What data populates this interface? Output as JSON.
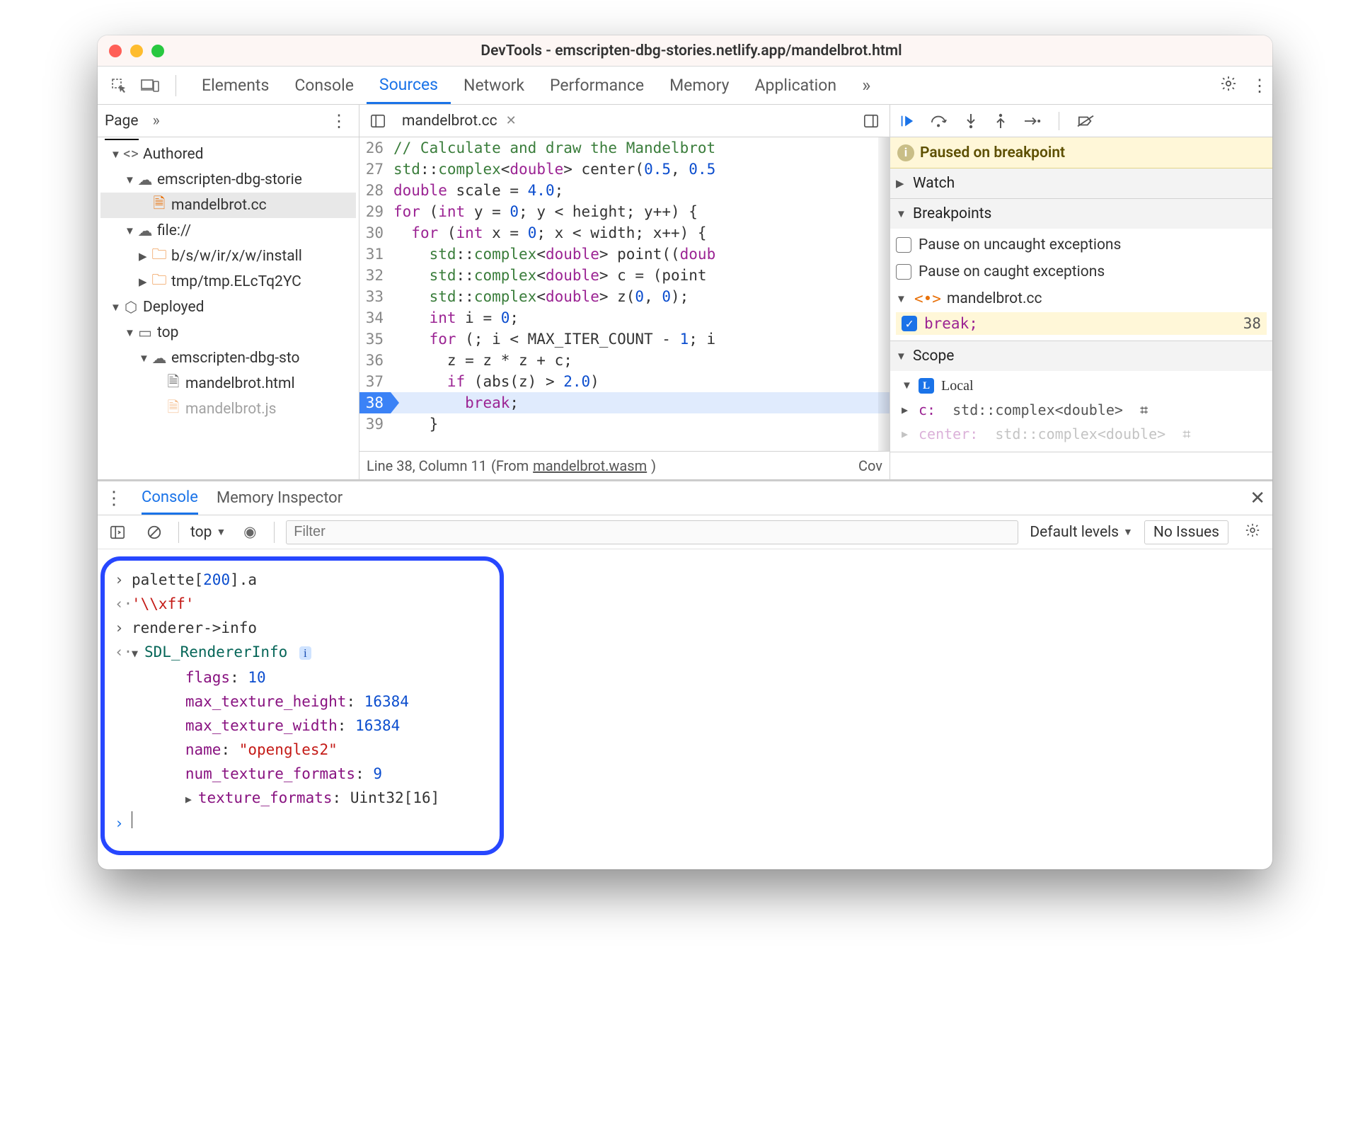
{
  "window": {
    "title": "DevTools - emscripten-dbg-stories.netlify.app/mandelbrot.html"
  },
  "toptabs": [
    "Elements",
    "Console",
    "Sources",
    "Network",
    "Performance",
    "Memory",
    "Application"
  ],
  "toptabs_active": "Sources",
  "left": {
    "page_label": "Page",
    "tree": {
      "authored": "Authored",
      "origin1": "emscripten-dbg-storie",
      "file1": "mandelbrot.cc",
      "fileorigin": "file://",
      "filesub1": "b/s/w/ir/x/w/install",
      "filesub2": "tmp/tmp.ELcTq2YC",
      "deployed": "Deployed",
      "top": "top",
      "origin2": "emscripten-dbg-sto",
      "html": "mandelbrot.html",
      "js": "mandelbrot.js"
    }
  },
  "editor": {
    "filename": "mandelbrot.cc",
    "status_line": "Line 38, Column 11",
    "status_from": "(From ",
    "status_wasm": "mandelbrot.wasm",
    "status_cov": "Cov",
    "lines": [
      {
        "n": 26,
        "html": "<span class='k-cm'>// Calculate and draw the Mandelbrot</span>"
      },
      {
        "n": 27,
        "html": "<span class='k-ns'>std</span>::<span class='k-ns'>complex</span>&lt;<span class='k-kw'>double</span>&gt; center(<span class='k-num'>0.5</span>, <span class='k-num'>0.5</span>"
      },
      {
        "n": 28,
        "html": "<span class='k-kw'>double</span> scale = <span class='k-num'>4.0</span>;"
      },
      {
        "n": 29,
        "html": "<span class='k-kw'>for</span> (<span class='k-kw'>int</span> y = <span class='k-num'>0</span>; y &lt; height; y++) {"
      },
      {
        "n": 30,
        "html": "  <span class='k-kw'>for</span> (<span class='k-kw'>int</span> x = <span class='k-num'>0</span>; x &lt; width; x++) {"
      },
      {
        "n": 31,
        "html": "    <span class='k-ns'>std</span>::<span class='k-ns'>complex</span>&lt;<span class='k-kw'>double</span>&gt; point((<span class='k-kw'>doub</span>"
      },
      {
        "n": 32,
        "html": "    <span class='k-ns'>std</span>::<span class='k-ns'>complex</span>&lt;<span class='k-kw'>double</span>&gt; c = (point "
      },
      {
        "n": 33,
        "html": "    <span class='k-ns'>std</span>::<span class='k-ns'>complex</span>&lt;<span class='k-kw'>double</span>&gt; z(<span class='k-num'>0</span>, <span class='k-num'>0</span>);"
      },
      {
        "n": 34,
        "html": "    <span class='k-kw'>int</span> i = <span class='k-num'>0</span>;"
      },
      {
        "n": 35,
        "html": "    <span class='k-kw'>for</span> (; i &lt; MAX_ITER_COUNT - <span class='k-num'>1</span>; i"
      },
      {
        "n": 36,
        "html": "      z = z * z + c;"
      },
      {
        "n": 37,
        "html": "      <span class='k-kw'>if</span> (abs(z) &gt; <span class='k-num'>2.0</span>)"
      },
      {
        "n": 38,
        "html": "        <span class='k-kw'>break</span>;",
        "exec": true
      },
      {
        "n": 39,
        "html": "    }"
      }
    ]
  },
  "debugger": {
    "paused": "Paused on breakpoint",
    "watch": "Watch",
    "breakpoints": "Breakpoints",
    "pause_uncaught": "Pause on uncaught exceptions",
    "pause_caught": "Pause on caught exceptions",
    "bp_file": "mandelbrot.cc",
    "bp_code": "break;",
    "bp_line": "38",
    "scope": "Scope",
    "local": "Local",
    "var1_name": "c:",
    "var1_type": "std::complex<double>",
    "var2_name": "center:",
    "var2_type": "std::complex<double>"
  },
  "drawer": {
    "tabs": [
      "Console",
      "Memory Inspector"
    ],
    "active": "Console",
    "ctx": "top",
    "filter_placeholder": "Filter",
    "levels": "Default levels",
    "issues": "No Issues"
  },
  "console": {
    "in1": "palette[200].a",
    "out1": "'\\\\xff'",
    "in2": "renderer->info",
    "struct": "SDL_RendererInfo",
    "fields": [
      {
        "k": "flags",
        "v": "10",
        "t": "num"
      },
      {
        "k": "max_texture_height",
        "v": "16384",
        "t": "num"
      },
      {
        "k": "max_texture_width",
        "v": "16384",
        "t": "num"
      },
      {
        "k": "name",
        "v": "\"opengles2\"",
        "t": "str"
      },
      {
        "k": "num_texture_formats",
        "v": "9",
        "t": "num"
      },
      {
        "k": "texture_formats",
        "v": "Uint32[16]",
        "t": "ref"
      }
    ]
  }
}
